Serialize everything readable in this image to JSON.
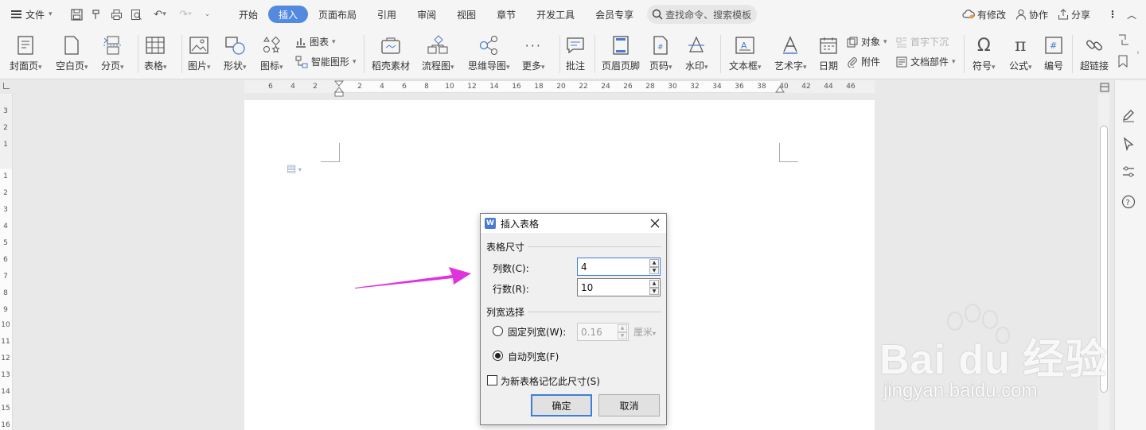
{
  "menubar": {
    "file_label": "文件",
    "tabs": [
      "开始",
      "插入",
      "页面布局",
      "引用",
      "审阅",
      "视图",
      "章节",
      "开发工具",
      "会员专享"
    ],
    "active_tab": "插入",
    "search_placeholder": "查找命令、搜索模板",
    "right": {
      "modified": "有修改",
      "collab": "协作",
      "share": "分享"
    }
  },
  "ribbon": {
    "cover": "封面页",
    "blank": "空白页",
    "pagebreak": "分页",
    "table": "表格",
    "picture": "图片",
    "shape": "形状",
    "icons": "图标",
    "chart": "图表",
    "smartart": "智能图形",
    "material": "稻壳素材",
    "flowchart": "流程图",
    "mindmap": "思维导图",
    "more": "更多",
    "comment": "批注",
    "headerfooter": "页眉页脚",
    "pagenum": "页码",
    "watermark": "水印",
    "textbox": "文本框",
    "wordart": "艺术字",
    "date": "日期",
    "object": "对象",
    "attachment": "附件",
    "dropcap": "首字下沉",
    "docpart": "文档部件",
    "symbol": "符号",
    "formula": "公式",
    "number": "编号",
    "hyperlink": "超链接"
  },
  "ruler": {
    "h_ticks": [
      "6",
      "4",
      "2",
      "2",
      "4",
      "6",
      "8",
      "10",
      "12",
      "14",
      "16",
      "18",
      "20",
      "22",
      "24",
      "26",
      "28",
      "30",
      "32",
      "34",
      "36",
      "38",
      "40",
      "42",
      "44",
      "46"
    ],
    "v_ticks": [
      "3",
      "2",
      "1",
      "1",
      "2",
      "3",
      "4",
      "5",
      "6",
      "7",
      "8",
      "9",
      "10",
      "11",
      "12",
      "13",
      "14",
      "15",
      "16"
    ]
  },
  "dialog": {
    "title": "插入表格",
    "size_group": "表格尺寸",
    "cols_label": "列数(C):",
    "cols_value": "4",
    "rows_label": "行数(R):",
    "rows_value": "10",
    "width_group": "列宽选择",
    "fixed_label": "固定列宽(W):",
    "fixed_value": "0.16",
    "unit": "厘米",
    "auto_label": "自动列宽(F)",
    "remember_label": "为新表格记忆此尺寸(S)",
    "ok": "确定",
    "cancel": "取消"
  },
  "watermark": {
    "brand": "Bai du 经验",
    "url": "jingyan.baidu.com"
  },
  "colors": {
    "accent": "#5389df",
    "arrow": "#e033e0",
    "dialog_focus": "#3c7fd8"
  }
}
